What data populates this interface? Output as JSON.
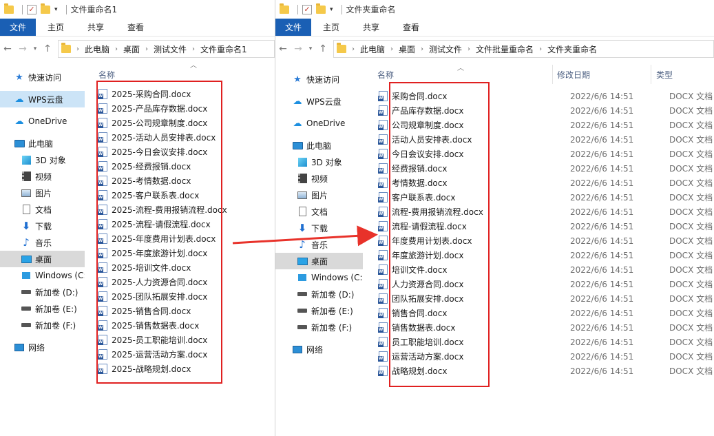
{
  "left_window": {
    "title": "文件重命名1",
    "ribbon_tabs": [
      "文件",
      "主页",
      "共享",
      "查看"
    ],
    "breadcrumb": [
      "此电脑",
      "桌面",
      "测试文件",
      "文件重命名1"
    ],
    "column_name": "名称",
    "nav_items": [
      {
        "label": "快速访问",
        "icon": "star-icon"
      },
      {
        "label": "WPS云盘",
        "icon": "cloud-icon"
      },
      {
        "label": "OneDrive",
        "icon": "onedrive-icon"
      },
      {
        "label": "此电脑",
        "icon": "pc-icon"
      },
      {
        "label": "3D 对象",
        "icon": "3d-objects-icon"
      },
      {
        "label": "视频",
        "icon": "video-icon"
      },
      {
        "label": "图片",
        "icon": "pictures-icon"
      },
      {
        "label": "文档",
        "icon": "documents-icon"
      },
      {
        "label": "下载",
        "icon": "download-icon"
      },
      {
        "label": "音乐",
        "icon": "music-icon"
      },
      {
        "label": "桌面",
        "icon": "desktop-icon"
      },
      {
        "label": "Windows (C:",
        "icon": "windows-drive-icon"
      },
      {
        "label": "新加卷 (D:)",
        "icon": "drive-icon"
      },
      {
        "label": "新加卷 (E:)",
        "icon": "drive-icon"
      },
      {
        "label": "新加卷 (F:)",
        "icon": "drive-icon"
      },
      {
        "label": "网络",
        "icon": "network-icon"
      }
    ],
    "files": [
      "2025-采购合同.docx",
      "2025-产品库存数据.docx",
      "2025-公司规章制度.docx",
      "2025-活动人员安排表.docx",
      "2025-今日会议安排.docx",
      "2025-经费报销.docx",
      "2025-考情数据.docx",
      "2025-客户联系表.docx",
      "2025-流程-费用报销流程.docx",
      "2025-流程-请假流程.docx",
      "2025-年度费用计划表.docx",
      "2025-年度旅游计划.docx",
      "2025-培训文件.docx",
      "2025-人力资源合同.docx",
      "2025-团队拓展安排.docx",
      "2025-销售合同.docx",
      "2025-销售数据表.docx",
      "2025-员工职能培训.docx",
      "2025-运营活动方案.docx",
      "2025-战略规划.docx"
    ]
  },
  "right_window": {
    "title": "文件夹重命名",
    "ribbon_tabs": [
      "文件",
      "主页",
      "共享",
      "查看"
    ],
    "breadcrumb": [
      "此电脑",
      "桌面",
      "测试文件",
      "文件批量重命名",
      "文件夹重命名"
    ],
    "columns": {
      "name": "名称",
      "date": "修改日期",
      "type": "类型"
    },
    "nav_items": [
      {
        "label": "快速访问",
        "icon": "star-icon"
      },
      {
        "label": "WPS云盘",
        "icon": "cloud-icon"
      },
      {
        "label": "OneDrive",
        "icon": "onedrive-icon"
      },
      {
        "label": "此电脑",
        "icon": "pc-icon"
      },
      {
        "label": "3D 对象",
        "icon": "3d-objects-icon"
      },
      {
        "label": "视频",
        "icon": "video-icon"
      },
      {
        "label": "图片",
        "icon": "pictures-icon"
      },
      {
        "label": "文档",
        "icon": "documents-icon"
      },
      {
        "label": "下载",
        "icon": "download-icon"
      },
      {
        "label": "音乐",
        "icon": "music-icon"
      },
      {
        "label": "桌面",
        "icon": "desktop-icon"
      },
      {
        "label": "Windows (C:",
        "icon": "windows-drive-icon"
      },
      {
        "label": "新加卷 (D:)",
        "icon": "drive-icon"
      },
      {
        "label": "新加卷 (E:)",
        "icon": "drive-icon"
      },
      {
        "label": "新加卷 (F:)",
        "icon": "drive-icon"
      },
      {
        "label": "网络",
        "icon": "network-icon"
      }
    ],
    "files": [
      {
        "name": "采购合同.docx",
        "date": "2022/6/6 14:51",
        "type": "DOCX 文档"
      },
      {
        "name": "产品库存数据.docx",
        "date": "2022/6/6 14:51",
        "type": "DOCX 文档"
      },
      {
        "name": "公司规章制度.docx",
        "date": "2022/6/6 14:51",
        "type": "DOCX 文档"
      },
      {
        "name": "活动人员安排表.docx",
        "date": "2022/6/6 14:51",
        "type": "DOCX 文档"
      },
      {
        "name": "今日会议安排.docx",
        "date": "2022/6/6 14:51",
        "type": "DOCX 文档"
      },
      {
        "name": "经费报销.docx",
        "date": "2022/6/6 14:51",
        "type": "DOCX 文档"
      },
      {
        "name": "考情数据.docx",
        "date": "2022/6/6 14:51",
        "type": "DOCX 文档"
      },
      {
        "name": "客户联系表.docx",
        "date": "2022/6/6 14:51",
        "type": "DOCX 文档"
      },
      {
        "name": "流程-费用报销流程.docx",
        "date": "2022/6/6 14:51",
        "type": "DOCX 文档"
      },
      {
        "name": "流程-请假流程.docx",
        "date": "2022/6/6 14:51",
        "type": "DOCX 文档"
      },
      {
        "name": "年度费用计划表.docx",
        "date": "2022/6/6 14:51",
        "type": "DOCX 文档"
      },
      {
        "name": "年度旅游计划.docx",
        "date": "2022/6/6 14:51",
        "type": "DOCX 文档"
      },
      {
        "name": "培训文件.docx",
        "date": "2022/6/6 14:51",
        "type": "DOCX 文档"
      },
      {
        "name": "人力资源合同.docx",
        "date": "2022/6/6 14:51",
        "type": "DOCX 文档"
      },
      {
        "name": "团队拓展安排.docx",
        "date": "2022/6/6 14:51",
        "type": "DOCX 文档"
      },
      {
        "name": "销售合同.docx",
        "date": "2022/6/6 14:51",
        "type": "DOCX 文档"
      },
      {
        "name": "销售数据表.docx",
        "date": "2022/6/6 14:51",
        "type": "DOCX 文档"
      },
      {
        "name": "员工职能培训.docx",
        "date": "2022/6/6 14:51",
        "type": "DOCX 文档"
      },
      {
        "name": "运营活动方案.docx",
        "date": "2022/6/6 14:51",
        "type": "DOCX 文档"
      },
      {
        "name": "战略规划.docx",
        "date": "2022/6/6 14:51",
        "type": "DOCX 文档"
      }
    ]
  },
  "colors": {
    "accent": "#1a5fb4",
    "highlight_box": "#e02020",
    "selected_nav": "#cce4f7"
  }
}
